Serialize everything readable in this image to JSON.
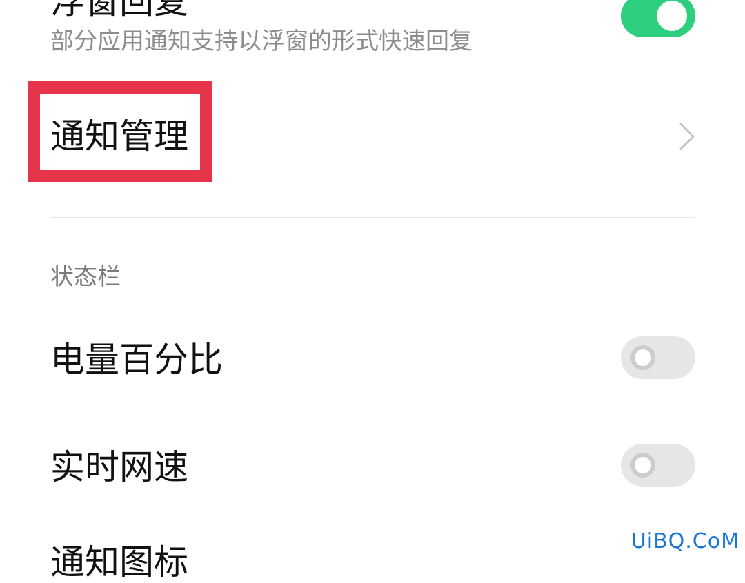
{
  "settings": {
    "floating_reply": {
      "title": "浮窗回复",
      "subtitle": "部分应用通知支持以浮窗的形式快速回复",
      "toggle_on": true
    },
    "notification_management": {
      "title": "通知管理",
      "chevron_icon": "chevron-right-icon"
    },
    "status_bar_section": {
      "header": "状态栏",
      "items": [
        {
          "title": "电量百分比",
          "toggle_on": false
        },
        {
          "title": "实时网速",
          "toggle_on": false
        },
        {
          "title": "通知图标"
        }
      ]
    }
  },
  "annotation": {
    "highlight_color": "#e6344a"
  },
  "watermark": {
    "text": "UiBQ.CoM"
  },
  "colors": {
    "toggle_on": "#2bcf7d",
    "toggle_off": "#e6e6e6",
    "title_text": "#111111",
    "secondary_text": "#8c8c8c"
  }
}
